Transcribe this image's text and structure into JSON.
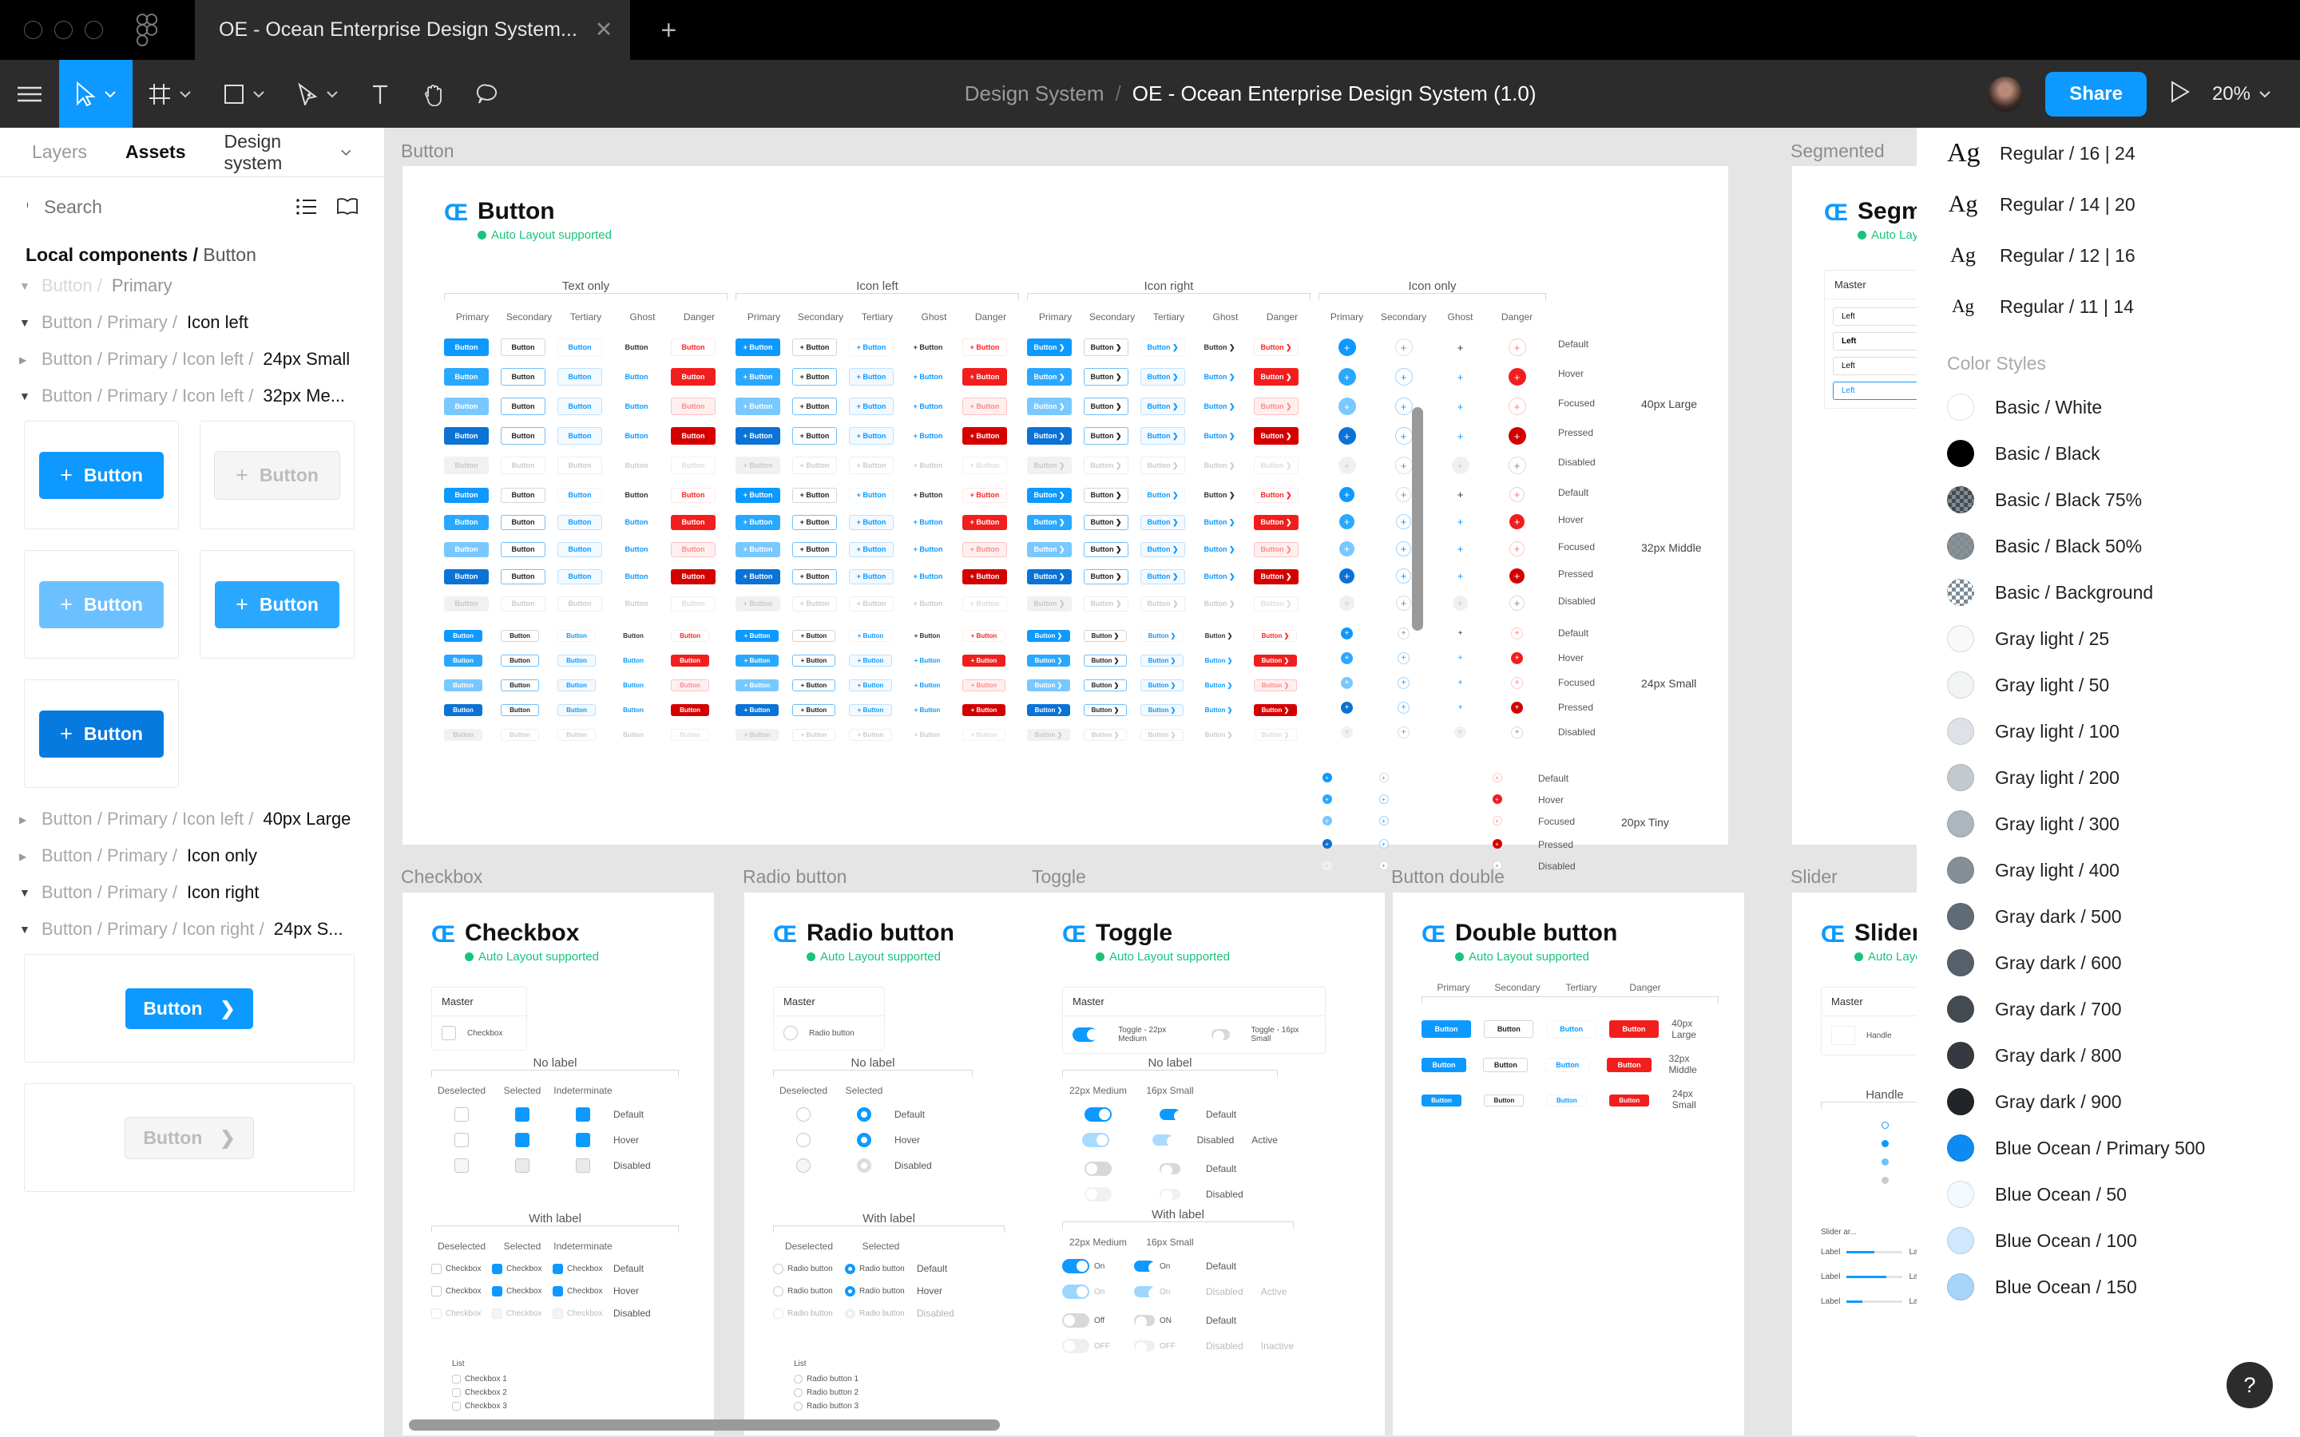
{
  "window": {
    "tab_title": "OE - Ocean Enterprise Design System...",
    "close_label": "✕",
    "new_tab_label": "+"
  },
  "toolbar": {
    "menu_icon": "hamburger-icon",
    "move_tool": "move-tool",
    "frame_tool": "frame-tool",
    "shape_tool": "shape-tool",
    "pen_tool": "pen-tool",
    "text_tool": "text-tool",
    "hand_tool": "hand-tool",
    "comment_tool": "comment-tool",
    "breadcrumb_project": "Design System",
    "breadcrumb_sep": "/",
    "file_name": "OE - Ocean Enterprise Design System (1.0)",
    "share_label": "Share",
    "present_label": "▶",
    "zoom_level": "20%"
  },
  "left_panel": {
    "tabs": [
      {
        "label": "Layers",
        "active": false
      },
      {
        "label": "Assets",
        "active": true
      },
      {
        "label": "Design system",
        "active": false,
        "dropdown": true
      }
    ],
    "search_placeholder": "Search",
    "breadcrumb_prefix": "Local components /",
    "breadcrumb_current": "Button",
    "tree": [
      {
        "prefix": "Button / ",
        "name": "Primary",
        "caret": "open",
        "faded": true
      },
      {
        "prefix": "Button / Primary / ",
        "name": "Icon left",
        "caret": "open",
        "faded": false
      },
      {
        "prefix": "Button / Primary / Icon left / ",
        "name": "24px Small",
        "caret": "closed",
        "faded": false
      },
      {
        "prefix": "Button / Primary / Icon left / ",
        "name": "32px Me...",
        "caret": "open",
        "faded": false
      },
      {
        "prefix": "Button / Primary / Icon left / ",
        "name": "40px Large",
        "caret": "closed",
        "faded": false
      },
      {
        "prefix": "Button / Primary / ",
        "name": "Icon only",
        "caret": "closed",
        "faded": false
      },
      {
        "prefix": "Button / Primary / ",
        "name": "Icon right",
        "caret": "open",
        "faded": false
      },
      {
        "prefix": "Button / Primary / Icon right / ",
        "name": "24px S...",
        "caret": "open",
        "faded": false
      }
    ],
    "assets_group_1": [
      {
        "label": "Button",
        "icon": "+",
        "state": "primary"
      },
      {
        "label": "Button",
        "icon": "+",
        "state": "disabled"
      },
      {
        "label": "Button",
        "icon": "+",
        "state": "focus"
      },
      {
        "label": "Button",
        "icon": "+",
        "state": "hover"
      },
      {
        "label": "Button",
        "icon": "+",
        "state": "pressed"
      }
    ],
    "assets_group_2": [
      {
        "label": "Button",
        "icon": "❯",
        "state": "primary"
      },
      {
        "label": "Button",
        "icon": "❯",
        "state": "disabled"
      }
    ]
  },
  "canvas": {
    "frames": [
      {
        "name": "Button"
      },
      {
        "name": "Segmented"
      },
      {
        "name": "Checkbox"
      },
      {
        "name": "Radio button"
      },
      {
        "name": "Toggle"
      },
      {
        "name": "Button double"
      },
      {
        "name": "Slider"
      }
    ],
    "button_frame": {
      "brand": "Œ",
      "title": "Button",
      "subtitle": "Auto Layout supported",
      "groups": [
        "Text only",
        "Icon left",
        "Icon right",
        "Icon only"
      ],
      "columns_full": [
        "Primary",
        "Secondary",
        "Tertiary",
        "Ghost",
        "Danger"
      ],
      "columns_icon_only": [
        "Primary",
        "Secondary",
        "Ghost",
        "Danger"
      ],
      "states": [
        "Default",
        "Hover",
        "Focused",
        "Pressed",
        "Disabled"
      ],
      "sizes": [
        "40px Large",
        "32px Middle",
        "24px Small",
        "20px Tiny"
      ],
      "button_text": "Button"
    },
    "checkbox_frame": {
      "brand": "Œ",
      "title": "Checkbox",
      "subtitle": "Auto Layout supported",
      "master_label": "Master",
      "master_item": "Checkbox",
      "sections": [
        "No label",
        "With label",
        "List"
      ],
      "columns": [
        "Deselected",
        "Selected",
        "Indeterminate"
      ],
      "states": [
        "Default",
        "Hover",
        "Disabled"
      ],
      "item_label": "Checkbox",
      "list_items": [
        "Checkbox 1",
        "Checkbox 2",
        "Checkbox 3"
      ]
    },
    "radio_frame": {
      "brand": "Œ",
      "title": "Radio button",
      "subtitle": "Auto Layout supported",
      "master_label": "Master",
      "master_item": "Radio button",
      "sections": [
        "No label",
        "With label",
        "List"
      ],
      "columns": [
        "Deselected",
        "Selected"
      ],
      "states": [
        "Default",
        "Hover",
        "Disabled"
      ],
      "item_label": "Radio button",
      "list_items": [
        "Radio button 1",
        "Radio button 2",
        "Radio button 3"
      ]
    },
    "toggle_frame": {
      "brand": "Œ",
      "title": "Toggle",
      "subtitle": "Auto Layout supported",
      "master_label": "Master",
      "master_items": [
        "Toggle - 22px Medium",
        "Toggle - 16px Small"
      ],
      "sections": [
        "No label",
        "With label"
      ],
      "columns": [
        "22px Medium",
        "16px Small"
      ],
      "states": [
        "Default",
        "Disabled"
      ],
      "row_groups": [
        "Active",
        "Inactive"
      ],
      "labels": [
        "On",
        "Off",
        "ON",
        "OFF"
      ]
    },
    "double_button_frame": {
      "brand": "Œ",
      "title": "Double button",
      "subtitle": "Auto Layout supported",
      "columns": [
        "Primary",
        "Secondary",
        "Tertiary",
        "Danger"
      ],
      "sizes": [
        "40px Large",
        "32px Middle",
        "24px Small"
      ],
      "button_text": "Button"
    },
    "segmented_frame": {
      "brand": "Œ",
      "title": "Segmented",
      "subtitle": "Auto Layout supported",
      "master_label": "Master",
      "items": [
        "Left",
        "Left",
        "Left",
        "Left"
      ]
    },
    "slider_frame": {
      "brand": "Œ",
      "title": "Slider",
      "subtitle": "Auto Layout supported",
      "master_label": "Master",
      "master_item": "Handle",
      "section": "Handle",
      "footer": "Slider ar..."
    }
  },
  "right_panel": {
    "text_styles": [
      {
        "preview": "Ag",
        "size": 34,
        "label": "Regular / 16 | 24"
      },
      {
        "preview": "Ag",
        "size": 30,
        "label": "Regular / 14 | 20"
      },
      {
        "preview": "Ag",
        "size": 26,
        "label": "Regular / 12 | 16"
      },
      {
        "preview": "Ag",
        "size": 23,
        "label": "Regular / 11 | 14"
      }
    ],
    "color_section_title": "Color Styles",
    "color_styles": [
      {
        "label": "Basic / White",
        "hex": "#ffffff",
        "pattern": "solid"
      },
      {
        "label": "Basic / Black",
        "hex": "#000000",
        "pattern": "solid"
      },
      {
        "label": "Basic / Black 75%",
        "hex": "#404040",
        "pattern": "half"
      },
      {
        "label": "Basic / Black 50%",
        "hex": "#808080",
        "pattern": "half"
      },
      {
        "label": "Basic / Background",
        "hex": "#ffffff",
        "pattern": "checker"
      },
      {
        "label": "Gray light / 25",
        "hex": "#f8f9fa",
        "pattern": "solid"
      },
      {
        "label": "Gray light / 50",
        "hex": "#f1f3f4",
        "pattern": "solid"
      },
      {
        "label": "Gray light / 100",
        "hex": "#dee2e6",
        "pattern": "solid"
      },
      {
        "label": "Gray light / 200",
        "hex": "#c4c9ce",
        "pattern": "solid"
      },
      {
        "label": "Gray light / 300",
        "hex": "#adb5bd",
        "pattern": "solid"
      },
      {
        "label": "Gray light / 400",
        "hex": "#868e96",
        "pattern": "solid"
      },
      {
        "label": "Gray dark / 500",
        "hex": "#5f6b76",
        "pattern": "solid"
      },
      {
        "label": "Gray dark / 600",
        "hex": "#55606a",
        "pattern": "solid"
      },
      {
        "label": "Gray dark / 700",
        "hex": "#424a52",
        "pattern": "solid"
      },
      {
        "label": "Gray dark / 800",
        "hex": "#343a40",
        "pattern": "solid"
      },
      {
        "label": "Gray dark / 900",
        "hex": "#212529",
        "pattern": "solid"
      },
      {
        "label": "Blue Ocean / Primary 500",
        "hex": "#0d8bf2",
        "pattern": "solid"
      },
      {
        "label": "Blue Ocean / 50",
        "hex": "#f2f9ff",
        "pattern": "solid"
      },
      {
        "label": "Blue Ocean / 100",
        "hex": "#cfe8fd",
        "pattern": "solid"
      },
      {
        "label": "Blue Ocean / 150",
        "hex": "#a6d4fb",
        "pattern": "solid"
      }
    ],
    "help_label": "?"
  },
  "colors": {
    "accent": "#0d99ff",
    "danger": "#f21e1e",
    "success": "#19c37d",
    "canvas_bg": "#e5e5e5",
    "chrome_bg": "#2c2c2c"
  }
}
